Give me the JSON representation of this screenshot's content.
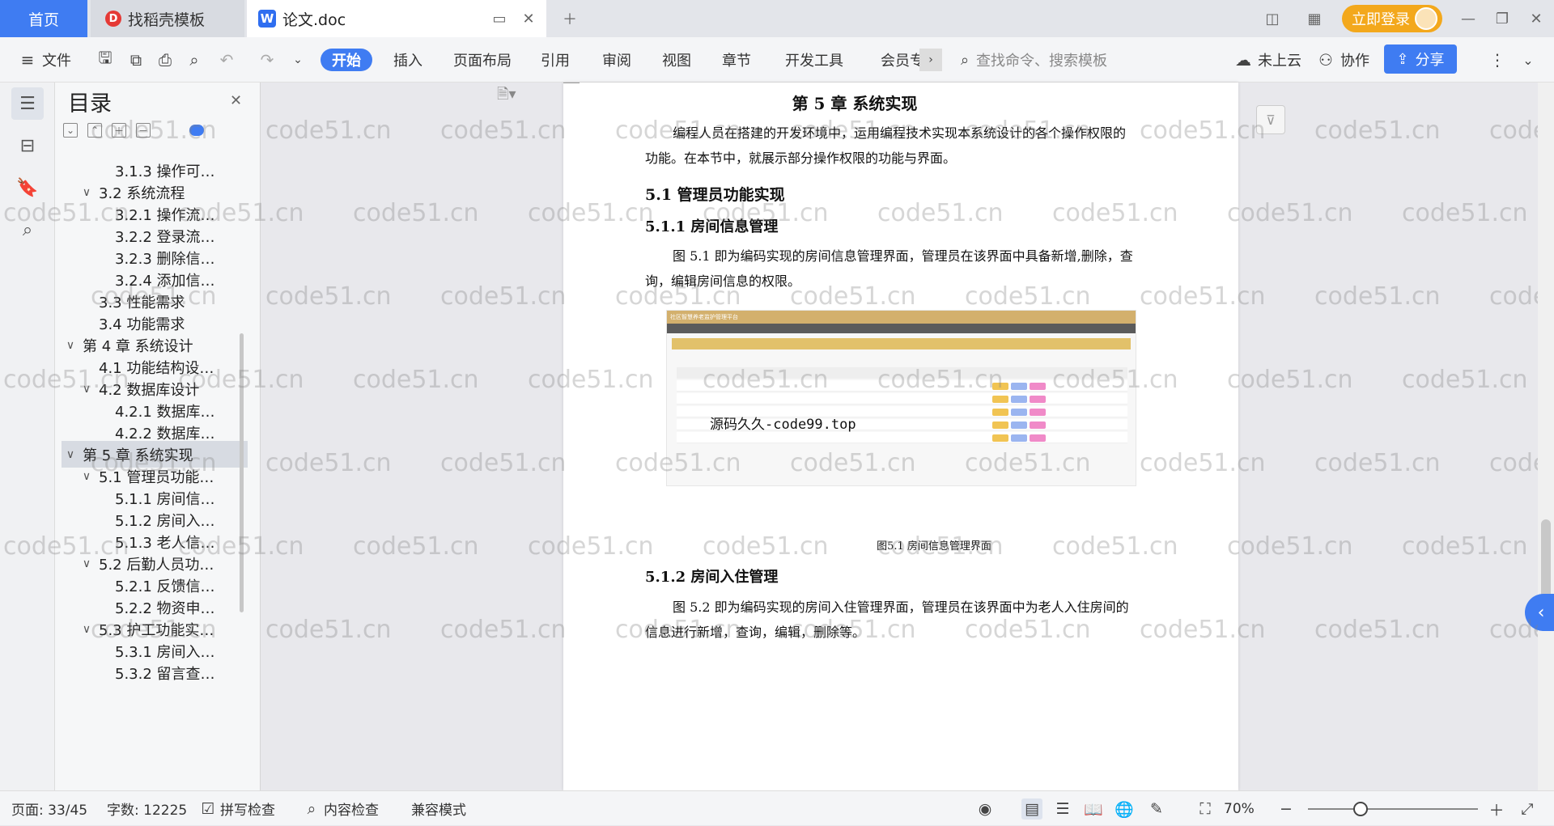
{
  "tabs": {
    "home": "首页",
    "templates": "找稻壳模板",
    "document": "论文.doc",
    "login": "立即登录"
  },
  "ribbon": {
    "file": "文件",
    "menus": [
      "开始",
      "插入",
      "页面布局",
      "引用",
      "审阅",
      "视图",
      "章节",
      "开发工具",
      "会员专"
    ],
    "search_placeholder": "查找命令、搜索模板",
    "cloud": "未上云",
    "collab": "协作",
    "share": "分享"
  },
  "toc": {
    "title": "目录",
    "items": [
      {
        "label": "3.1.3  操作可…",
        "level": 3
      },
      {
        "label": "3.2  系统流程",
        "level": 2,
        "expanded": true
      },
      {
        "label": "3.2.1  操作流…",
        "level": 3
      },
      {
        "label": "3.2.2  登录流…",
        "level": 3
      },
      {
        "label": "3.2.3  删除信…",
        "level": 3
      },
      {
        "label": "3.2.4  添加信…",
        "level": 3
      },
      {
        "label": "3.3  性能需求",
        "level": 2
      },
      {
        "label": "3.4  功能需求",
        "level": 2
      },
      {
        "label": "第 4 章  系统设计",
        "level": 1,
        "expanded": true
      },
      {
        "label": "4.1  功能结构设…",
        "level": 2
      },
      {
        "label": "4.2  数据库设计",
        "level": 2,
        "expanded": true
      },
      {
        "label": "4.2.1  数据库…",
        "level": 3
      },
      {
        "label": "4.2.2  数据库…",
        "level": 3
      },
      {
        "label": "第 5 章  系统实现",
        "level": 1,
        "expanded": true,
        "active": true
      },
      {
        "label": "5.1  管理员功能…",
        "level": 2,
        "expanded": true
      },
      {
        "label": "5.1.1  房间信…",
        "level": 3
      },
      {
        "label": "5.1.2  房间入…",
        "level": 3
      },
      {
        "label": "5.1.3  老人信…",
        "level": 3
      },
      {
        "label": "5.2  后勤人员功…",
        "level": 2,
        "expanded": true
      },
      {
        "label": "5.2.1  反馈信…",
        "level": 3
      },
      {
        "label": "5.2.2  物资申…",
        "level": 3
      },
      {
        "label": "5.3  护工功能实…",
        "level": 2,
        "expanded": true
      },
      {
        "label": "5.3.1  房间入…",
        "level": 3
      },
      {
        "label": "5.3.2  留言查…",
        "level": 3
      }
    ]
  },
  "document": {
    "chapter_title": "第 5 章  系统实现",
    "intro": "编程人员在搭建的开发环境中，运用编程技术实现本系统设计的各个操作权限的功能。在本节中，就展示部分操作权限的功能与界面。",
    "h_5_1": "5.1  管理员功能实现",
    "h_5_1_1": "5.1.1  房间信息管理",
    "p_5_1_1": "图 5.1 即为编码实现的房间信息管理界面，管理员在该界面中具备新增,删除，查询，编辑房间信息的权限。",
    "figure_app_title": "社区智慧养老监护管理平台",
    "figure_overlay": "源码久久-code99.top",
    "fig_caption": "图5.1  房间信息管理界面",
    "h_5_1_2": "5.1.2  房间入住管理",
    "p_5_1_2": "图 5.2 即为编码实现的房间入住管理界面，管理员在该界面中为老人入住房间的信息进行新增，查询，编辑，删除等。"
  },
  "status": {
    "page": "页面: 33/45",
    "words": "字数: 12225",
    "spellcheck": "拼写检查",
    "content_check": "内容检查",
    "compat": "兼容模式",
    "zoom": "70%"
  },
  "watermark": "code51.cn",
  "colors": {
    "accent": "#3f7cf2",
    "login": "#f3a81c",
    "figure_header": "#d3b06d"
  }
}
